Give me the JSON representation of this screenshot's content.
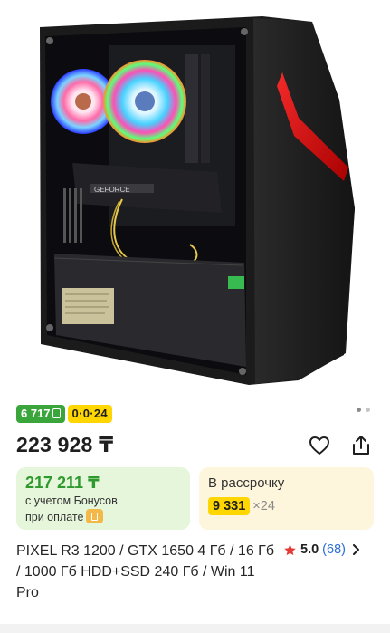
{
  "product": {
    "image_alt": "PC case with RGB fans",
    "bonus_badge": "6 717",
    "installment_badge": "0·0·24",
    "price": "223 928 ₸",
    "bonus_price": "217 211 ₸",
    "bonus_line1": "с учетом Бонусов",
    "bonus_line2": "при оплате",
    "installment_title": "В рассрочку",
    "installment_amount": "9 331",
    "installment_multiplier": "×24",
    "title": "PIXEL R3 1200 / GTX 1650 4 Гб / 16 Гб / 1000 Гб HDD+SSD 240 Гб / Win 11 Pro",
    "rating": "5.0",
    "reviews": "(68)"
  },
  "colors": {
    "bonus_green": "#3aa53a",
    "installment_yellow": "#ffd600",
    "rating_star": "#e53935",
    "link_blue": "#2a6ed8"
  },
  "icons": {
    "favorite": "heart-icon",
    "share": "share-icon",
    "star": "star-icon",
    "chevron": "chevron-right-icon"
  }
}
